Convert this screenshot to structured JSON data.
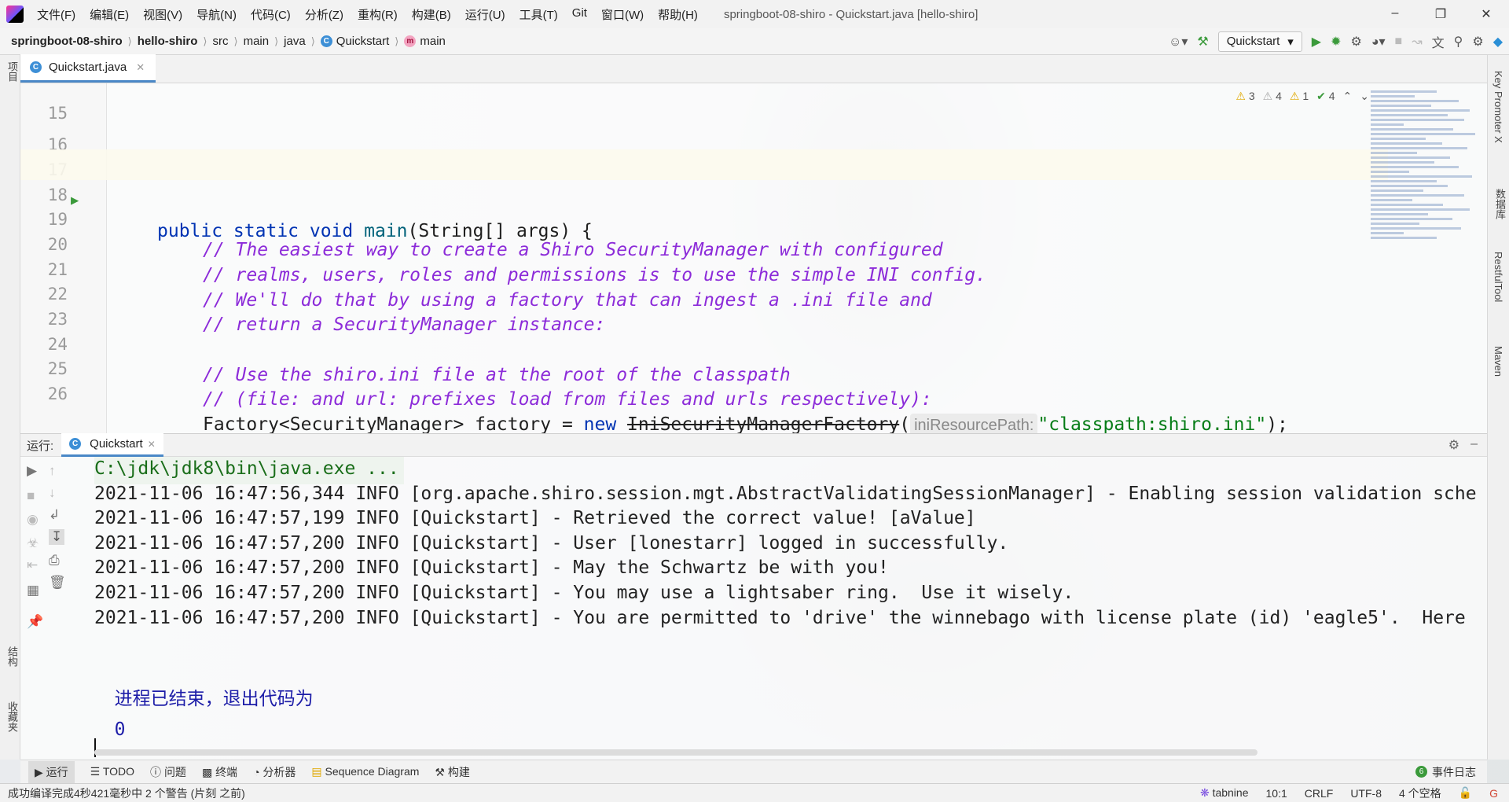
{
  "titlebar": {
    "menu": [
      "文件(F)",
      "编辑(E)",
      "视图(V)",
      "导航(N)",
      "代码(C)",
      "分析(Z)",
      "重构(R)",
      "构建(B)",
      "运行(U)",
      "工具(T)",
      "Git",
      "窗口(W)",
      "帮助(H)"
    ],
    "title": "springboot-08-shiro - Quickstart.java [hello-shiro]"
  },
  "navbar": {
    "crumbs": [
      "springboot-08-shiro",
      "hello-shiro",
      "src",
      "main",
      "java",
      "Quickstart",
      "main"
    ],
    "run_config": "Quickstart"
  },
  "left_strip": {
    "project": "项目",
    "structure": "结构",
    "favorites": "收藏夹"
  },
  "right_strip": {
    "key_promoter": "Key Promoter X",
    "database": "数据库",
    "restful": "RestfulTool",
    "maven": "Maven"
  },
  "editor": {
    "tab": "Quickstart.java",
    "inspections": {
      "warnings": "3",
      "weak_warnings": "4",
      "typos": "1",
      "ok": "4"
    },
    "lines": [
      {
        "n": "15"
      },
      {
        "n": "16"
      },
      {
        "n": "17",
        "kw": "public static void ",
        "fn": "main",
        "rest": "(String[] args) {"
      },
      {
        "n": "18"
      },
      {
        "n": "19",
        "comment": "// The easiest way to create a Shiro SecurityManager with configured"
      },
      {
        "n": "20",
        "comment": "// realms, users, roles and permissions is to use the simple INI config."
      },
      {
        "n": "21",
        "comment": "// We'll do that by using a factory that can ingest a .ini file and"
      },
      {
        "n": "22",
        "comment": "// return a SecurityManager instance:"
      },
      {
        "n": "23"
      },
      {
        "n": "24",
        "comment": "// Use the shiro.ini file at the root of the classpath"
      },
      {
        "n": "25",
        "comment": "// (file: and url: prefixes load from files and urls respectively):"
      },
      {
        "n": "26",
        "a": "Factory<SecurityManager> factory = ",
        "kw2": "new ",
        "cls": "IniSecurityManagerFactory",
        "paren": "(",
        "hint": "iniResourcePath:",
        "str": "\"classpath:shiro.ini\"",
        "end": ");"
      }
    ]
  },
  "run": {
    "label": "运行:",
    "tab": "Quickstart",
    "console": [
      "C:\\jdk\\jdk8\\bin\\java.exe ...",
      "2021-11-06 16:47:56,344 INFO [org.apache.shiro.session.mgt.AbstractValidatingSessionManager] - Enabling session validation sche",
      "2021-11-06 16:47:57,199 INFO [Quickstart] - Retrieved the correct value! [aValue]",
      "2021-11-06 16:47:57,200 INFO [Quickstart] - User [lonestarr] logged in successfully.",
      "2021-11-06 16:47:57,200 INFO [Quickstart] - May the Schwartz be with you!",
      "2021-11-06 16:47:57,200 INFO [Quickstart] - You may use a lightsaber ring.  Use it wisely.",
      "2021-11-06 16:47:57,200 INFO [Quickstart] - You are permitted to 'drive' the winnebago with license plate (id) 'eagle5'.  Here"
    ],
    "exit_text": "进程已结束，退出代码为",
    "exit_code": "0"
  },
  "bottom_tabs": {
    "items": [
      "运行",
      "TODO",
      "问题",
      "终端",
      "分析器",
      "Sequence Diagram",
      "构建"
    ],
    "events_badge": "6",
    "events": "事件日志"
  },
  "status": {
    "message": "成功编译完成4秒421毫秒中 2 个警告 (片刻 之前)",
    "tabnine": "tabnine",
    "position": "10:1",
    "line_sep": "CRLF",
    "encoding": "UTF-8",
    "indent": "4 个空格"
  }
}
